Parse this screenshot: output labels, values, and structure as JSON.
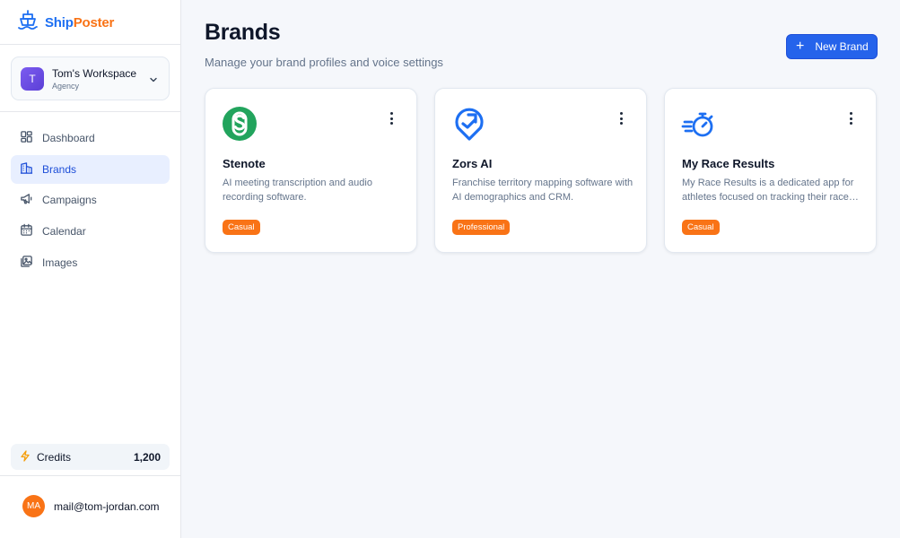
{
  "app": {
    "logo_ship": "Ship",
    "logo_poster": "Poster"
  },
  "workspace": {
    "avatar_letter": "T",
    "name": "Tom's Workspace",
    "type": "Agency"
  },
  "nav": {
    "items": [
      {
        "label": "Dashboard",
        "icon": "dashboard-icon",
        "active": false
      },
      {
        "label": "Brands",
        "icon": "building-icon",
        "active": true
      },
      {
        "label": "Campaigns",
        "icon": "megaphone-icon",
        "active": false
      },
      {
        "label": "Calendar",
        "icon": "calendar-icon",
        "active": false
      },
      {
        "label": "Images",
        "icon": "images-icon",
        "active": false
      }
    ]
  },
  "credits": {
    "label": "Credits",
    "value": "1,200"
  },
  "user": {
    "initials": "MA",
    "email": "mail@tom-jordan.com"
  },
  "page": {
    "title": "Brands",
    "subtitle": "Manage your brand profiles and voice settings",
    "new_button_label": "New Brand"
  },
  "brands": [
    {
      "name": "Stenote",
      "description": "AI meeting transcription and audio recording software.",
      "tag": "Casual",
      "logo": "stenote-logo"
    },
    {
      "name": "Zors AI",
      "description": "Franchise territory mapping software with AI demographics and CRM.",
      "tag": "Professional",
      "logo": "zors-logo"
    },
    {
      "name": "My Race Results",
      "description": "My Race Results is a dedicated app for athletes focused on tracking their race results.",
      "tag": "Casual",
      "logo": "stopwatch-logo"
    }
  ],
  "colors": {
    "primary": "#2563eb",
    "accent": "#f97316",
    "active_nav_bg": "#e8efff",
    "stenote_green": "#22a45d"
  }
}
